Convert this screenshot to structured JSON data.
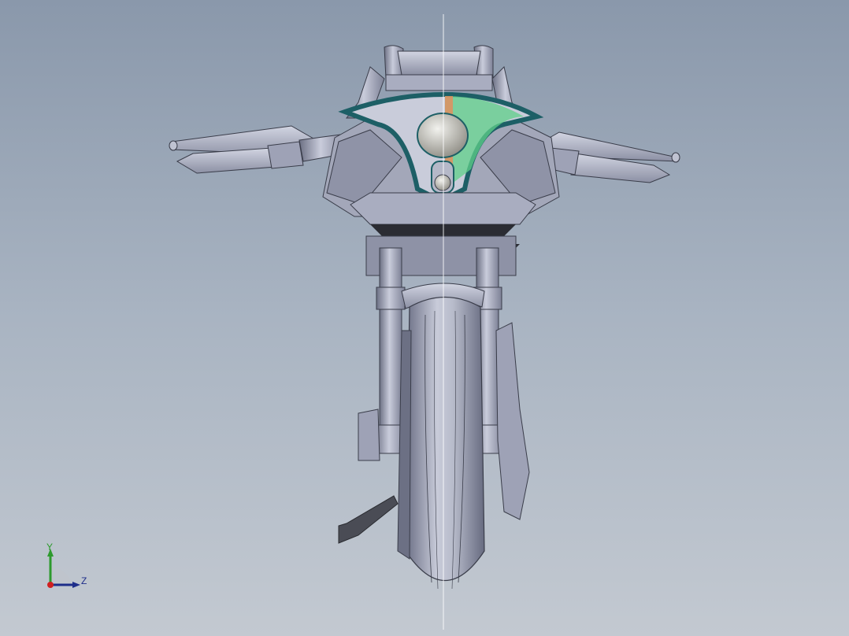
{
  "viewport": {
    "background_top": "#8a98ab",
    "background_bottom": "#c3c9d1",
    "model": "motorcycle-front-view",
    "section_plane_color": "#ffffff",
    "highlight_color": "#5fd089"
  },
  "triad": {
    "y_label": "Y",
    "z_label": "Z",
    "y_color": "#2d9a2d",
    "z_color": "#1e2e8a",
    "x_color": "#d02020"
  }
}
